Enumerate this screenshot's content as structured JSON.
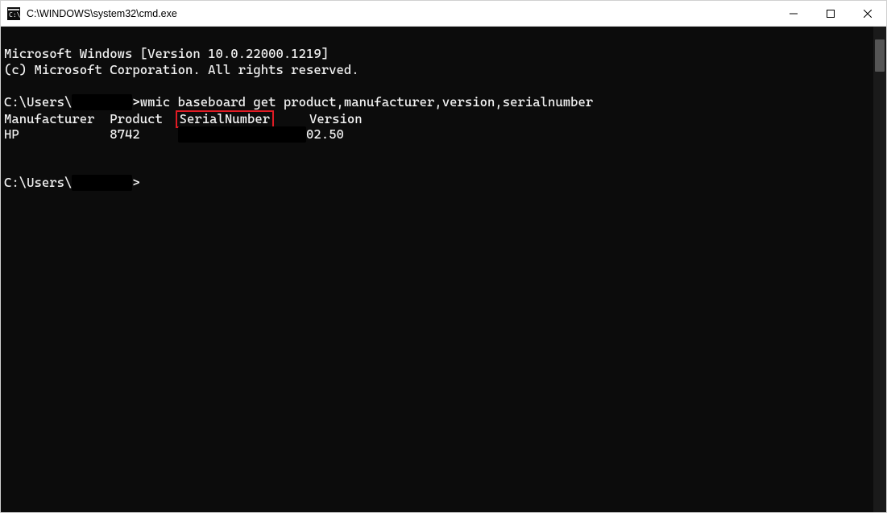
{
  "window": {
    "title": "C:\\WINDOWS\\system32\\cmd.exe"
  },
  "terminal": {
    "banner_line1": "Microsoft Windows [Version 10.0.22000.1219]",
    "banner_line2": "(c) Microsoft Corporation. All rights reserved.",
    "prompt_prefix": "C:\\Users\\",
    "prompt_user_redacted": "        ",
    "command": ">wmic baseboard get product,manufacturer,version,serialnumber",
    "headers": {
      "manufacturer": "Manufacturer",
      "product": "Product",
      "serial": "SerialNumber",
      "version": "Version"
    },
    "row": {
      "manufacturer": "HP",
      "product": "8742",
      "serial_redacted": "              ",
      "version": "02.50"
    },
    "prompt2_prefix": "C:\\Users\\",
    "prompt2_user_redacted": "        ",
    "prompt2_suffix": ">"
  }
}
